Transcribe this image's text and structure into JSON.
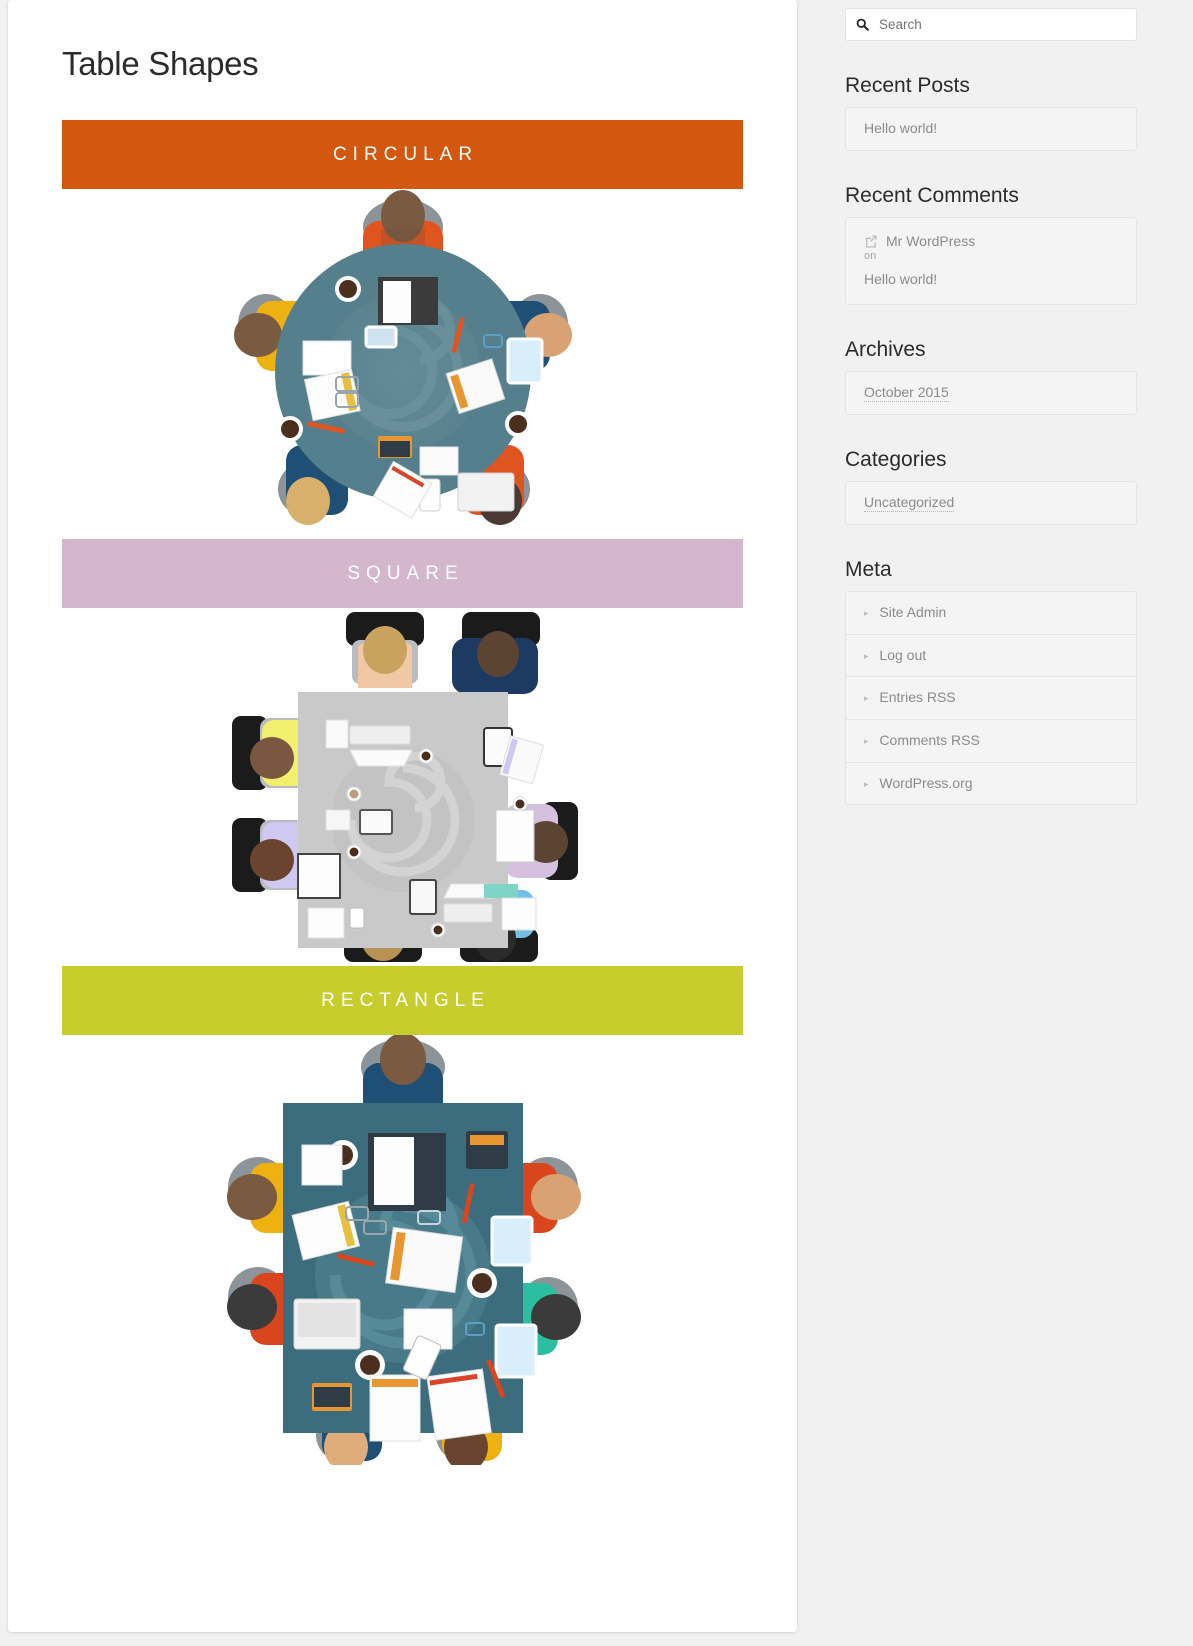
{
  "main": {
    "title": "Table Shapes",
    "sections": [
      {
        "label": "CIRCULAR",
        "banner_color": "#d3570f",
        "figure": "circular-table-meeting-illustration"
      },
      {
        "label": "SQUARE",
        "banner_color": "#d4b7cd",
        "figure": "square-table-meeting-illustration"
      },
      {
        "label": "RECTANGLE",
        "banner_color": "#c6cd2d",
        "figure": "rectangle-table-meeting-illustration"
      }
    ]
  },
  "sidebar": {
    "search": {
      "placeholder": "Search",
      "value": "",
      "icon": "search-icon"
    },
    "widgets": [
      {
        "title": "Recent Posts",
        "type": "list",
        "items": [
          {
            "label": "Hello world!"
          }
        ]
      },
      {
        "title": "Recent Comments",
        "type": "comments",
        "comments": [
          {
            "icon": "external-link-icon",
            "author": "Mr WordPress",
            "connector": "on",
            "post": "Hello world!"
          }
        ]
      },
      {
        "title": "Archives",
        "type": "list",
        "items": [
          {
            "label": "October 2015",
            "dotted": true
          }
        ]
      },
      {
        "title": "Categories",
        "type": "list",
        "items": [
          {
            "label": "Uncategorized",
            "dotted": true
          }
        ]
      },
      {
        "title": "Meta",
        "type": "list",
        "items": [
          {
            "label": "Site Admin",
            "caret": true
          },
          {
            "label": "Log out",
            "caret": true
          },
          {
            "label": "Entries RSS",
            "caret": true,
            "abbr": "RSS"
          },
          {
            "label": "Comments RSS",
            "caret": true,
            "abbr": "RSS"
          },
          {
            "label": "WordPress.org",
            "caret": true
          }
        ]
      }
    ]
  },
  "colors": {
    "page_background": "#f1f1f1",
    "panel_background": "#ffffff",
    "text_primary": "#2b2b2b",
    "text_muted": "#8b8b8b",
    "circular_banner": "#d3570f",
    "square_banner": "#d4b7cd",
    "rectangle_banner": "#c6cd2d",
    "circular_table": "#557f8c",
    "square_table": "#c9c9c9",
    "rectangle_table": "#3b6d7e"
  }
}
